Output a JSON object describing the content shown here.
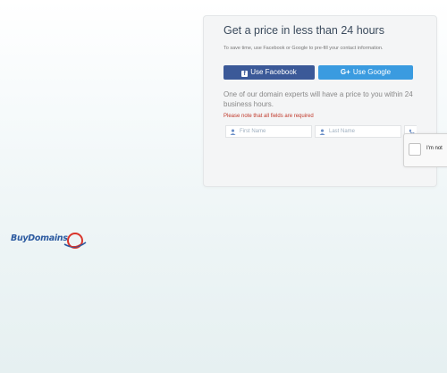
{
  "logo": {
    "text": "BuyDomains"
  },
  "card": {
    "title": "Get a price in less than 24 hours",
    "subtitle": "To save time, use Facebook or Google to pre-fill your contact information.",
    "facebook_button": "Use Facebook",
    "google_button": "Use Google",
    "google_icon": "G+",
    "description": "One of our domain experts will have a price to you within 24 business hours.",
    "note": "Please note that all fields are required",
    "first_name_placeholder": "First Name",
    "last_name_placeholder": "Last Name"
  },
  "recaptcha": {
    "label": "I'm not"
  },
  "colors": {
    "facebook": "#3b5998",
    "google": "#3a9be0",
    "note": "#c0392b",
    "logo": "#2c5aa0"
  }
}
